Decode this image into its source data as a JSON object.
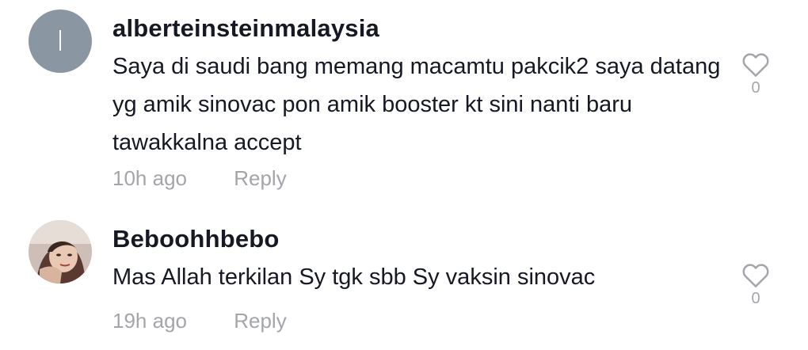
{
  "comments": [
    {
      "avatar_initial": "I",
      "avatar_icon": "initial-avatar",
      "username": "alberteinsteinmalaysia",
      "text": "Saya di saudi bang memang macamtu pakcik2 saya datang yg amik sinovac pon amik booster kt sini nanti baru tawakkalna accept",
      "time": "10h ago",
      "reply_label": "Reply",
      "likes": "0",
      "like_icon": "heart-outline-icon"
    },
    {
      "avatar_icon": "photo-avatar",
      "username": "Beboohhbebo",
      "text": "Mas Allah terkilan Sy tgk sbb Sy vaksin sinovac",
      "time": "19h ago",
      "reply_label": "Reply",
      "likes": "0",
      "like_icon": "heart-outline-icon"
    }
  ],
  "colors": {
    "text_primary": "#161823",
    "text_secondary": "#a4a5aa",
    "avatar_gray": "#8a97a3"
  }
}
